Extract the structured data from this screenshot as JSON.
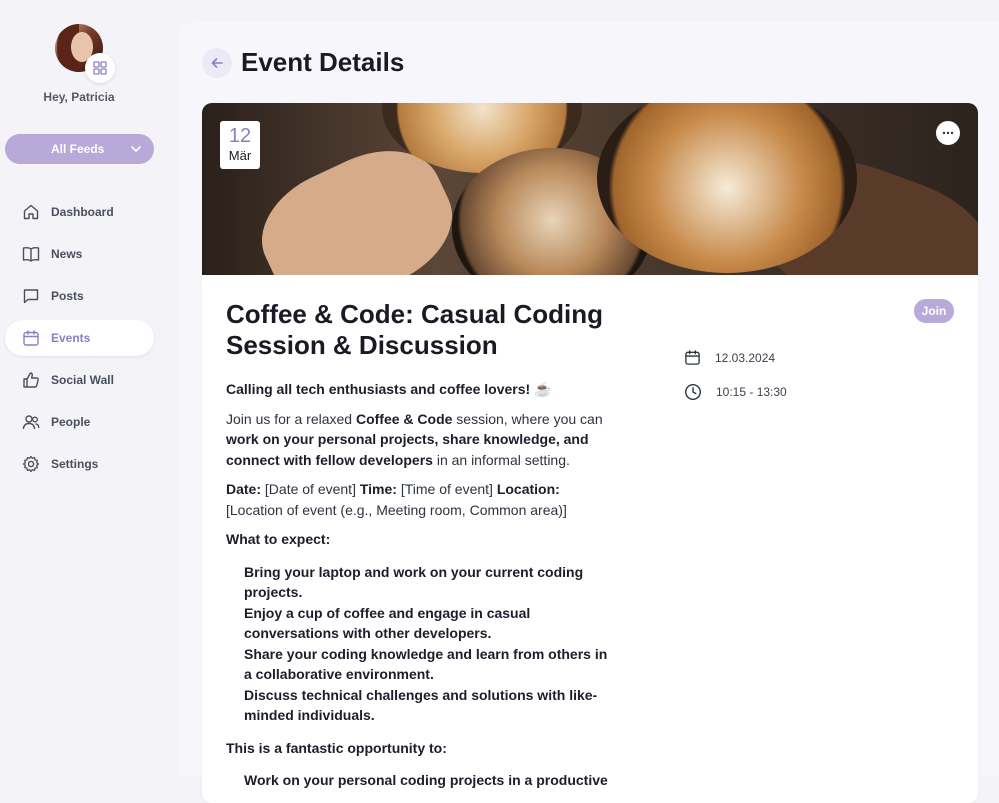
{
  "user": {
    "greeting": "Hey, Patricia"
  },
  "feed_select": {
    "value": "All Feeds"
  },
  "nav": {
    "items": [
      {
        "label": "Dashboard",
        "icon": "home-icon"
      },
      {
        "label": "News",
        "icon": "book-icon"
      },
      {
        "label": "Posts",
        "icon": "chat-icon"
      },
      {
        "label": "Events",
        "icon": "calendar-icon",
        "active": true
      },
      {
        "label": "Social Wall",
        "icon": "thumbs-up-icon"
      },
      {
        "label": "People",
        "icon": "people-icon"
      },
      {
        "label": "Settings",
        "icon": "gear-icon"
      }
    ]
  },
  "page": {
    "title": "Event Details"
  },
  "event": {
    "date_day": "12",
    "date_month": "Mär",
    "title": "Coffee & Code: Casual Coding Session & Discussion",
    "join_label": "Join",
    "date": "12.03.2024",
    "time": "10:15 - 13:30",
    "intro": "Calling all tech enthusiasts and coffee lovers! ☕️",
    "para1_a": "Join us for a relaxed ",
    "para1_b": "Coffee & Code",
    "para1_c": " session, where you can ",
    "para1_d": "work on your personal projects, share knowledge, and connect with fellow developers",
    "para1_e": " in an informal setting.",
    "date_label": "Date:",
    "date_value": " [Date of event] ",
    "time_label": "Time:",
    "time_value": " [Time of event] ",
    "location_label": "Location:",
    "location_value": " [Location of event (e.g., Meeting room, Common area)]",
    "expect_heading": "What to expect:",
    "expect_items": [
      "Bring your laptop and work on your current coding projects.",
      "Enjoy a cup of coffee and engage in casual conversations with other developers.",
      "Share your coding knowledge and learn from others in a collaborative environment.",
      "Discuss technical challenges and solutions with like-minded individuals."
    ],
    "opportunity_heading": "This is a fantastic opportunity to:",
    "opportunity_items": [
      "Work on your personal coding projects in a productive"
    ]
  },
  "colors": {
    "accent": "#8e7cc3",
    "accent_soft": "#b8a9d9"
  }
}
